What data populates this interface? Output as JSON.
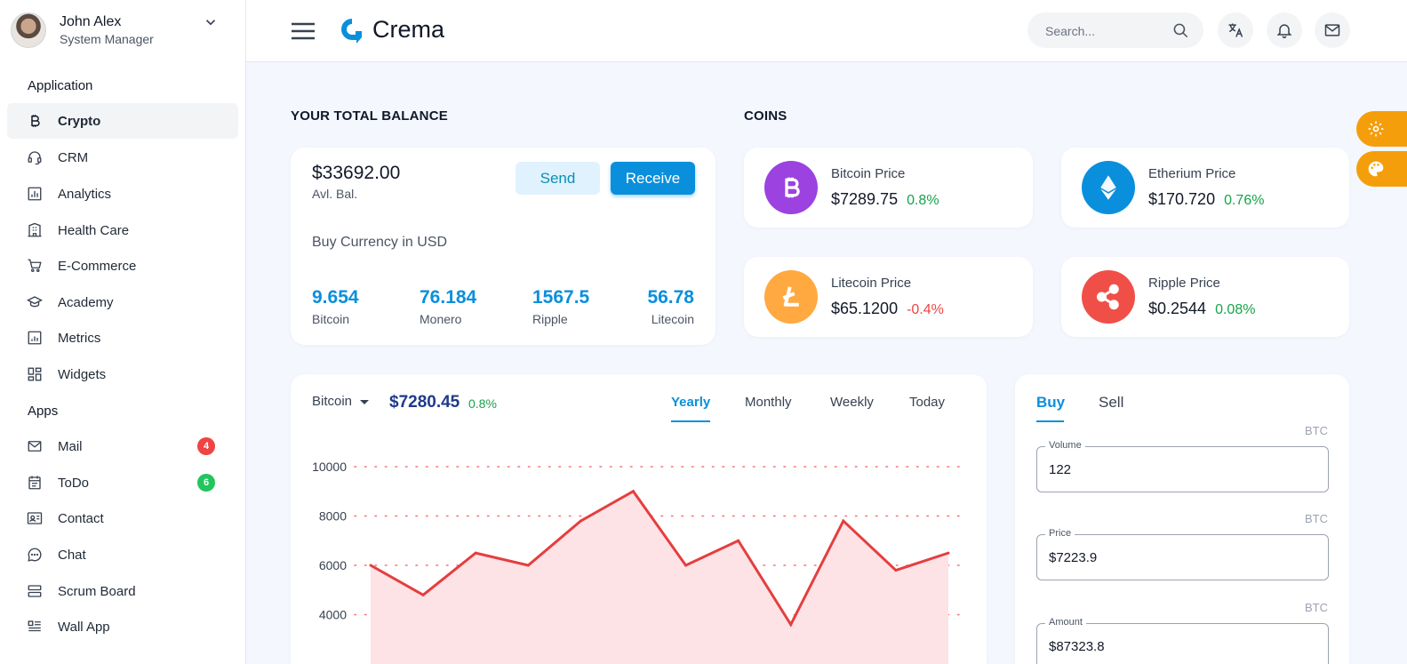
{
  "user": {
    "name": "John Alex",
    "role": "System Manager"
  },
  "sidebar": {
    "sections": [
      "Application",
      "Apps"
    ],
    "application_items": [
      {
        "label": "Crypto",
        "icon": "bitcoin-icon"
      },
      {
        "label": "CRM",
        "icon": "headset-icon"
      },
      {
        "label": "Analytics",
        "icon": "bar-chart-icon"
      },
      {
        "label": "Health Care",
        "icon": "building-icon"
      },
      {
        "label": "E-Commerce",
        "icon": "cart-icon"
      },
      {
        "label": "Academy",
        "icon": "graduation-cap-icon"
      },
      {
        "label": "Metrics",
        "icon": "metrics-icon"
      },
      {
        "label": "Widgets",
        "icon": "widgets-icon"
      }
    ],
    "apps_items": [
      {
        "label": "Mail",
        "icon": "mail-icon",
        "badge": "4",
        "badge_color": "#ef4444"
      },
      {
        "label": "ToDo",
        "icon": "calendar-icon",
        "badge": "6",
        "badge_color": "#22c55e"
      },
      {
        "label": "Contact",
        "icon": "contact-card-icon"
      },
      {
        "label": "Chat",
        "icon": "chat-icon"
      },
      {
        "label": "Scrum Board",
        "icon": "board-icon"
      },
      {
        "label": "Wall App",
        "icon": "wall-icon"
      }
    ]
  },
  "header": {
    "brand": "Crema",
    "search_placeholder": "Search..."
  },
  "balance": {
    "title": "YOUR TOTAL BALANCE",
    "amount": "$33692.00",
    "sub": "Avl. Bal.",
    "send": "Send",
    "receive": "Receive",
    "buy_title": "Buy Currency in USD",
    "currencies": [
      {
        "value": "9.654",
        "name": "Bitcoin"
      },
      {
        "value": "76.184",
        "name": "Monero"
      },
      {
        "value": "1567.5",
        "name": "Ripple"
      },
      {
        "value": "56.78",
        "name": "Litecoin"
      }
    ]
  },
  "coins": {
    "title": "COINS",
    "items": [
      {
        "name": "Bitcoin Price",
        "price": "$7289.75",
        "change": "0.8%",
        "color": "#9b42e0",
        "change_color": "#16a34a"
      },
      {
        "name": "Etherium Price",
        "price": "$170.720",
        "change": "0.76%",
        "color": "#0a8fdc",
        "change_color": "#16a34a"
      },
      {
        "name": "Litecoin Price",
        "price": "$65.1200",
        "change": "-0.4%",
        "color": "#ffa940",
        "change_color": "#ef4444"
      },
      {
        "name": "Ripple Price",
        "price": "$0.2544",
        "change": "0.08%",
        "color": "#f04f47",
        "change_color": "#16a34a"
      }
    ]
  },
  "chart_panel": {
    "coin": "Bitcoin",
    "price": "$7280.45",
    "change": "0.8%",
    "tabs": [
      "Yearly",
      "Monthly",
      "Weekly",
      "Today"
    ],
    "active_tab": "Yearly"
  },
  "chart_data": {
    "type": "area",
    "x": [
      1,
      2,
      3,
      4,
      5,
      6,
      7,
      8,
      9,
      10,
      11,
      12
    ],
    "values": [
      6000,
      4800,
      6500,
      6000,
      7800,
      9000,
      6000,
      7000,
      3600,
      7800,
      5800,
      6500
    ],
    "yticks": [
      10000,
      8000,
      6000,
      4000
    ],
    "ylim": [
      2500,
      10500
    ],
    "line_color": "#e53e3e",
    "fill_color": "#fde2e6",
    "grid": "dotted horizontal"
  },
  "trade": {
    "tabs": [
      "Buy",
      "Sell"
    ],
    "active_tab": "Buy",
    "fields": [
      {
        "label": "Volume",
        "value": "122",
        "unit": "BTC"
      },
      {
        "label": "Price",
        "value": "$7223.9",
        "unit": "BTC"
      },
      {
        "label": "Amount",
        "value": "$87323.8",
        "unit": "BTC"
      }
    ]
  },
  "colors": {
    "primary": "#0a8fdc",
    "accent": "#f59e0b"
  }
}
